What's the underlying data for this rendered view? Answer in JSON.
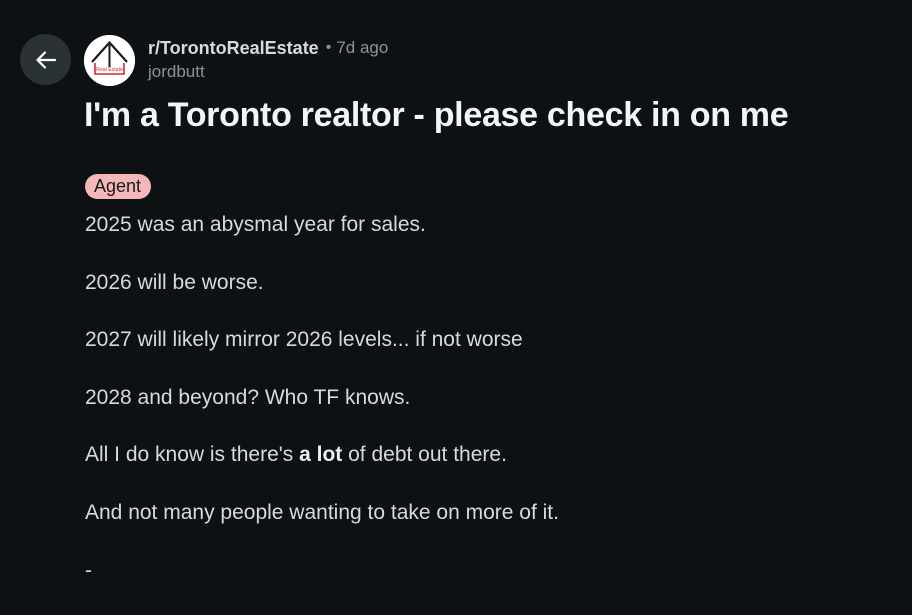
{
  "post": {
    "subreddit": "r/TorontoRealEstate",
    "separator": "•",
    "age": "7d ago",
    "author": "jordbutt",
    "avatar_text": "Real Estate",
    "title": "I'm a Toronto realtor - please check in on me",
    "flair": "Agent",
    "body": {
      "p1": "2025 was an abysmal year for sales.",
      "p2": "2026 will be worse.",
      "p3": "2027 will likely mirror 2026 levels... if not worse",
      "p4": "2028 and beyond? Who TF knows.",
      "p5_before": "All I do know is there's ",
      "p5_bold": "a lot",
      "p5_after": " of debt out there.",
      "p6": "And not many people wanting to take on more of it.",
      "p7": "-"
    }
  },
  "icons": {
    "back": "arrow-left-icon"
  },
  "colors": {
    "background": "#0e1113",
    "back_button": "#2a3236",
    "flair_background": "#f4b8b8",
    "text": "#d7dadc",
    "muted_text": "#8a9499",
    "title_text": "#f2f4f5",
    "logo_red": "#d8252e"
  }
}
